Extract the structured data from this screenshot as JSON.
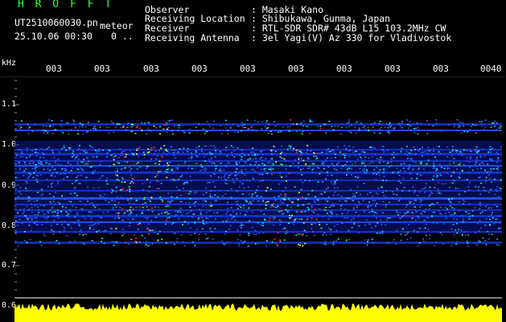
{
  "header": {
    "title": "H R O F F T",
    "file_name": "UT2510060030.pn",
    "file_tag": "meteor",
    "date_time": "25.10.06 00:30",
    "dots": "0 .."
  },
  "info": [
    {
      "label": "Observer",
      "value": ": Masaki Kano"
    },
    {
      "label": "Receiving Location",
      "value": ": Shibukawa, Gunma, Japan"
    },
    {
      "label": "Receiver",
      "value": ": RTL-SDR SDR# 43dB L15 103.2MHz CW"
    },
    {
      "label": "Receiving Antenna",
      "value": ": 3el Yagi(V) Az 330 for Vladivostok"
    }
  ],
  "axis": {
    "unit": "kHz",
    "y_ticks": [
      "1.1",
      "1.0",
      "0.9",
      "0.8",
      "0.7",
      "0.6"
    ],
    "x_ticks": [
      "003",
      "003",
      "003",
      "003",
      "003",
      "003",
      "003",
      "003",
      "003",
      "0040"
    ]
  },
  "colors": {
    "text": "#ffffff",
    "title": "#33ff33",
    "background": "#000000",
    "power_trace": "#ffff00",
    "spectrum_low": "#1010a0",
    "spectrum_mid": "#00ffff",
    "spectrum_high": "#ff3030"
  }
}
